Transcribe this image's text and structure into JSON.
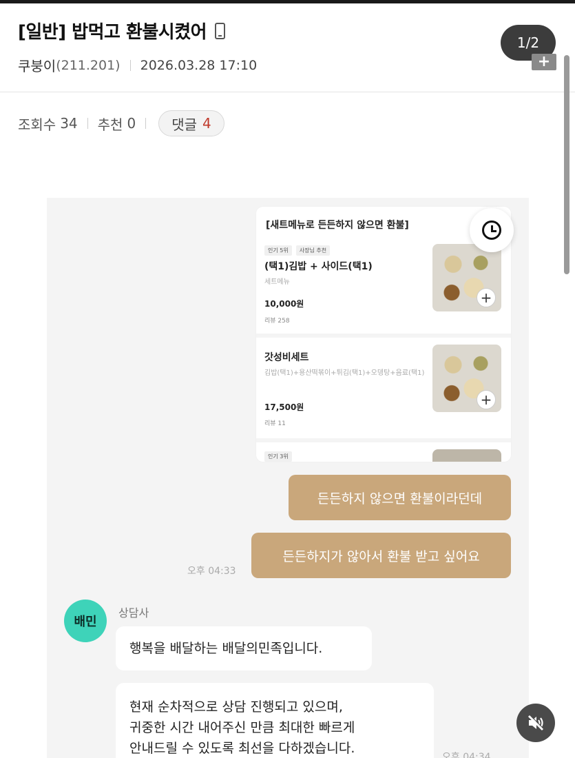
{
  "post": {
    "title": "[일반] 밥먹고 환불시켰어",
    "author": "쿠붕이",
    "ip": "(211.201)",
    "date": "2026.03.28 17:10",
    "views_label": "조회수",
    "views": "34",
    "recommend_label": "추천",
    "recommend": "0",
    "comments_label": "댓글",
    "comments": "4"
  },
  "viewer": {
    "page_indicator": "1/2",
    "plus_label": "+"
  },
  "menu_card": {
    "title": "[새트메뉴로 든든하지 않으면 환불]",
    "items": [
      {
        "tag1": "인기 5위",
        "tag2": "사장님 추천",
        "name": "(택1)김밥 + 사이드(택1)",
        "sub": "세트메뉴",
        "price": "10,000원",
        "review": "리뷰 258"
      },
      {
        "name": "갓성비세트",
        "sub": "김밥(택1)+용산떡볶이+튀김(택1)+오뎅탕+음료(택1)",
        "price": "17,500원",
        "review": "리뷰 11"
      },
      {
        "tag1": "인기 3위"
      }
    ]
  },
  "chat": {
    "my_messages": [
      "든든하지 않으면 환불이라던데",
      "든든하지가 않아서 환불 받고 싶어요"
    ],
    "my_time": "오후 04:33",
    "agent_avatar": "배민",
    "agent_name": "상담사",
    "agent_messages": [
      "행복을 배달하는 배달의민족입니다.",
      "현재 순차적으로 상담 진행되고 있으며,",
      "귀중한 시간 내어주신 만큼 최대한 빠르게",
      "안내드릴 수 있도록 최선을 다하겠습니다."
    ],
    "agent_time": "오후 04:34"
  },
  "colors": {
    "my_bubble": "#c9a77b",
    "avatar_bg": "#3ed3b9",
    "comment_count": "#c0392b"
  },
  "icons": {
    "title_icon": "mobile-phone-icon",
    "clock": "clock-icon",
    "mute": "speaker-muted-icon"
  }
}
